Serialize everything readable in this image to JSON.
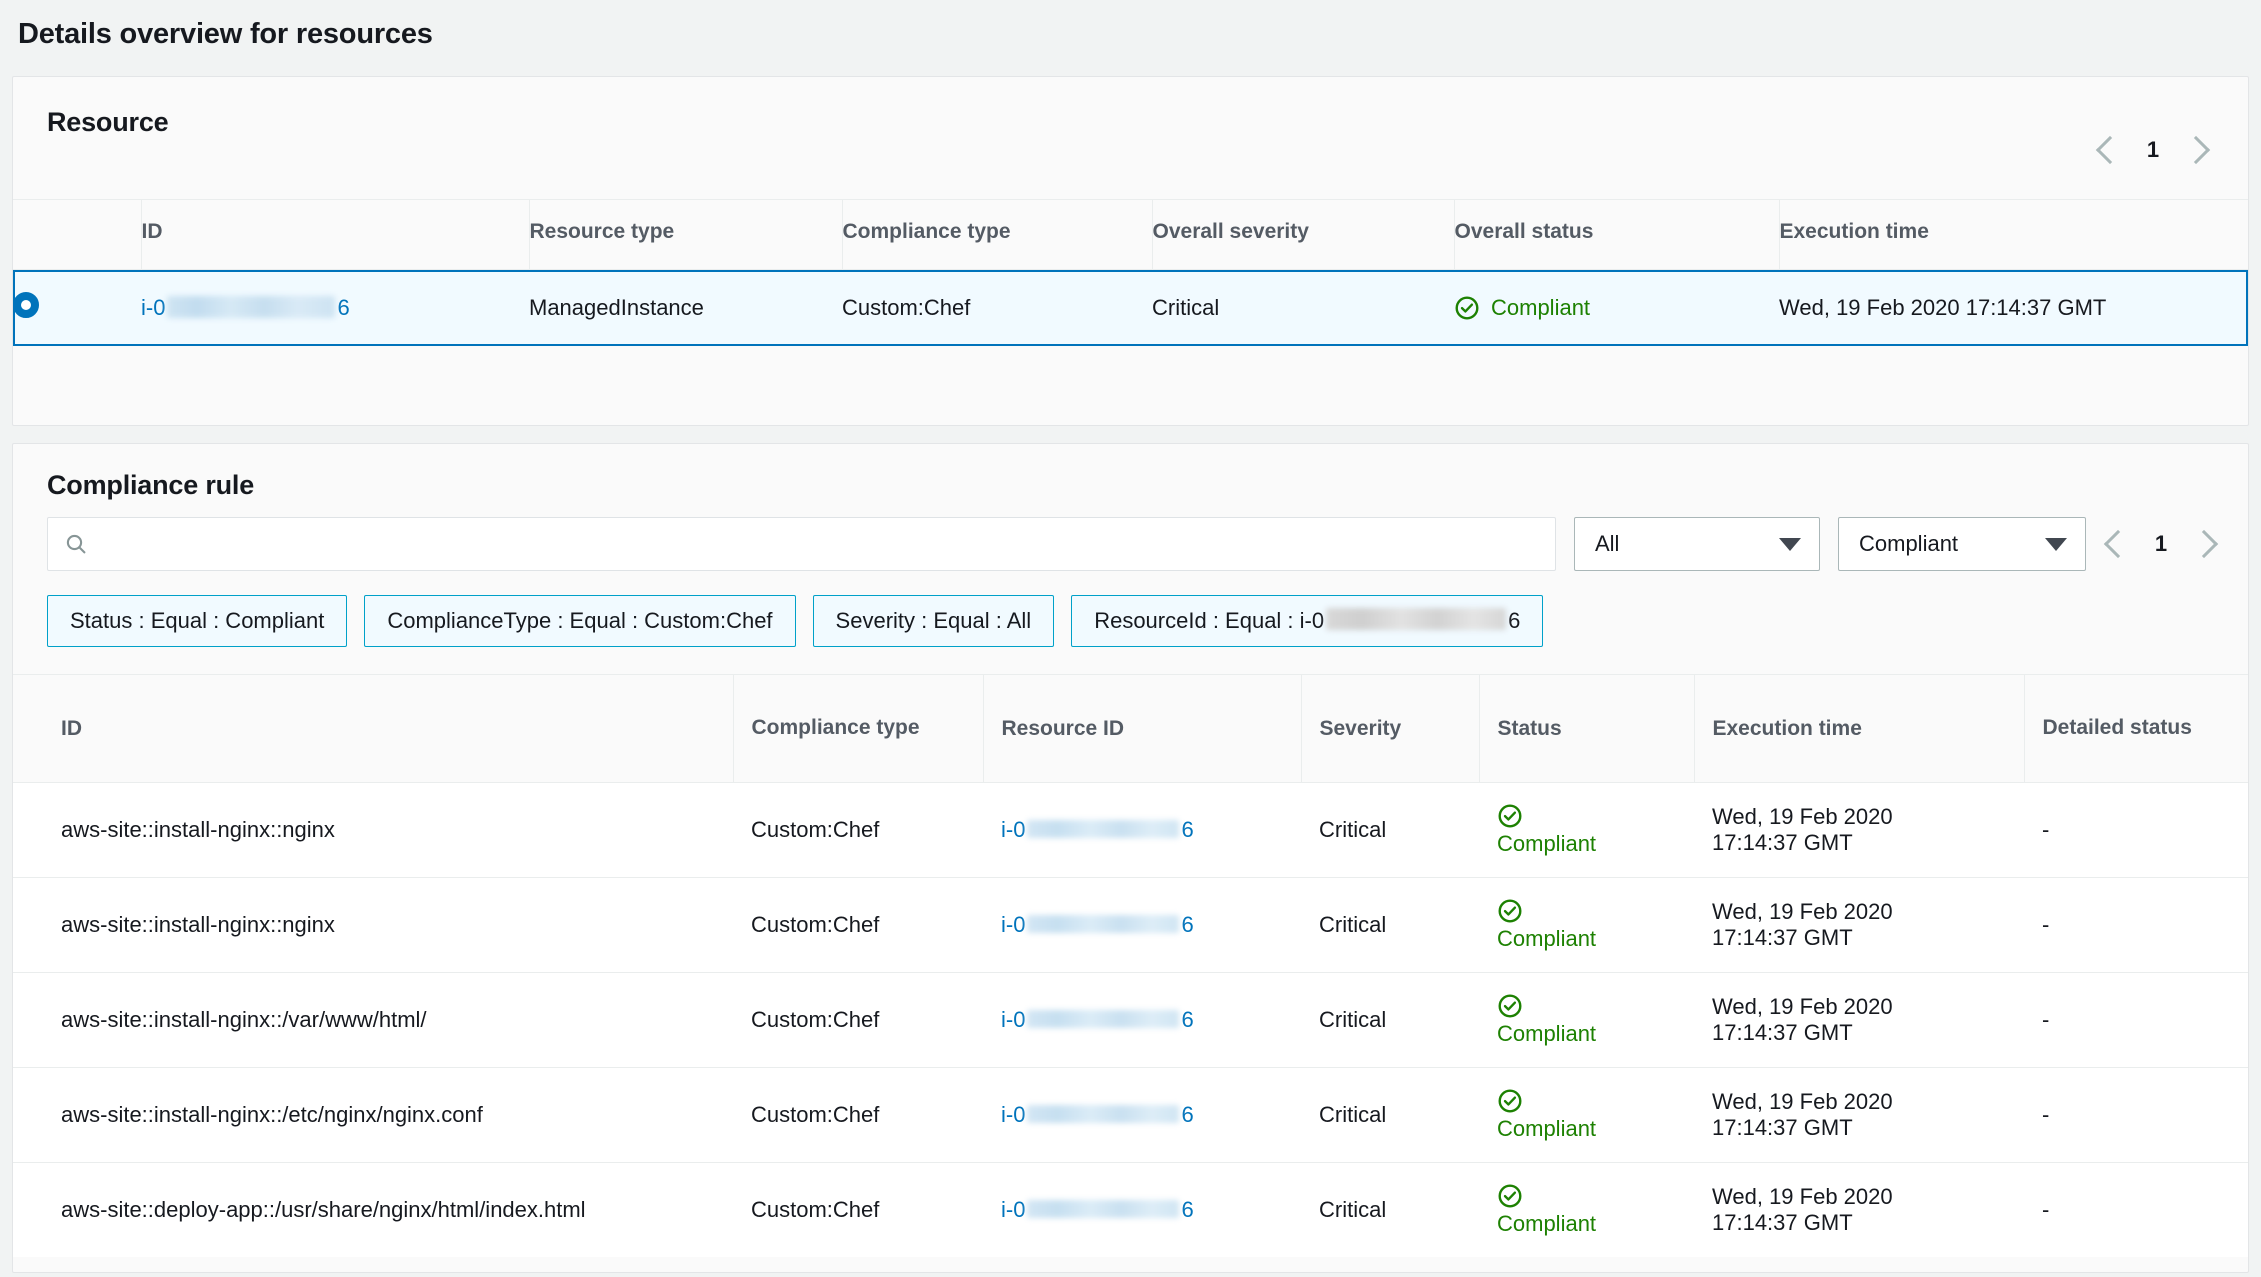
{
  "page": {
    "title": "Details overview for resources"
  },
  "resource_section": {
    "title": "Resource",
    "pagination": {
      "prev_label": "Previous page",
      "page_number": "1",
      "next_label": "Next page"
    },
    "columns": [
      "ID",
      "Resource type",
      "Compliance type",
      "Overall severity",
      "Overall status",
      "Execution time"
    ],
    "rows": [
      {
        "selected": true,
        "id_prefix": "i-0",
        "id_suffix": "6",
        "resource_type": "ManagedInstance",
        "compliance_type": "Custom:Chef",
        "overall_severity": "Critical",
        "overall_status": "Compliant",
        "execution_time": "Wed, 19 Feb 2020 17:14:37 GMT"
      }
    ]
  },
  "rule_section": {
    "title": "Compliance rule",
    "search": {
      "placeholder": "",
      "value": "",
      "icon": "search-icon"
    },
    "filters": {
      "severity_select": {
        "value": "All",
        "icon": "chevron-down-icon"
      },
      "status_select": {
        "value": "Compliant",
        "icon": "chevron-down-icon"
      }
    },
    "pagination": {
      "prev_label": "Previous page",
      "page_number": "1",
      "next_label": "Next page"
    },
    "tokens": [
      "Status : Equal : Compliant",
      "ComplianceType : Equal : Custom:Chef",
      "Severity : Equal : All"
    ],
    "token_resource": {
      "prefix": "ResourceId : Equal : i-0",
      "suffix": "6"
    },
    "columns": [
      "ID",
      "Compliance type",
      "Resource ID",
      "Severity",
      "Status",
      "Execution time",
      "Detailed status"
    ],
    "rows": [
      {
        "id": "aws-site::install-nginx::nginx",
        "compliance_type": "Custom:Chef",
        "resource_id_prefix": "i-0",
        "resource_id_suffix": "6",
        "severity": "Critical",
        "status": "Compliant",
        "execution_date": "Wed, 19 Feb 2020",
        "execution_time": "17:14:37 GMT",
        "detailed_status": "-"
      },
      {
        "id": "aws-site::install-nginx::nginx",
        "compliance_type": "Custom:Chef",
        "resource_id_prefix": "i-0",
        "resource_id_suffix": "6",
        "severity": "Critical",
        "status": "Compliant",
        "execution_date": "Wed, 19 Feb 2020",
        "execution_time": "17:14:37 GMT",
        "detailed_status": "-"
      },
      {
        "id": "aws-site::install-nginx::/var/www/html/",
        "compliance_type": "Custom:Chef",
        "resource_id_prefix": "i-0",
        "resource_id_suffix": "6",
        "severity": "Critical",
        "status": "Compliant",
        "execution_date": "Wed, 19 Feb 2020",
        "execution_time": "17:14:37 GMT",
        "detailed_status": "-"
      },
      {
        "id": "aws-site::install-nginx::/etc/nginx/nginx.conf",
        "compliance_type": "Custom:Chef",
        "resource_id_prefix": "i-0",
        "resource_id_suffix": "6",
        "severity": "Critical",
        "status": "Compliant",
        "execution_date": "Wed, 19 Feb 2020",
        "execution_time": "17:14:37 GMT",
        "detailed_status": "-"
      },
      {
        "id": "aws-site::deploy-app::/usr/share/nginx/html/index.html",
        "compliance_type": "Custom:Chef",
        "resource_id_prefix": "i-0",
        "resource_id_suffix": "6",
        "severity": "Critical",
        "status": "Compliant",
        "execution_date": "Wed, 19 Feb 2020",
        "execution_time": "17:14:37 GMT",
        "detailed_status": "-"
      }
    ]
  },
  "colors": {
    "page_background": "#f1f3f3",
    "card_background": "#fafafa",
    "link": "#0073bb",
    "selected_row": "#f1faff",
    "selected_border": "#0073bb",
    "compliant_green": "#1d8102",
    "token_border": "#00a1c9",
    "header_text": "#545b64",
    "body_text": "#16191f"
  }
}
